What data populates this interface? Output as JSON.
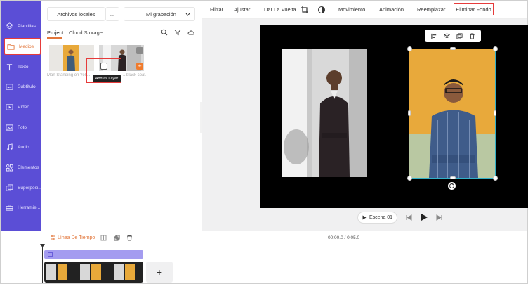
{
  "sidebar": {
    "items": [
      {
        "label": "Plantillas",
        "icon": "layers-icon"
      },
      {
        "label": "Medios",
        "icon": "folder-icon"
      },
      {
        "label": "Texto",
        "icon": "text-icon"
      },
      {
        "label": "Subtítulo",
        "icon": "subtitle-icon"
      },
      {
        "label": "Vídeo",
        "icon": "video-icon"
      },
      {
        "label": "Foto",
        "icon": "photo-icon"
      },
      {
        "label": "Audio",
        "icon": "music-icon"
      },
      {
        "label": "Elementos",
        "icon": "elements-icon"
      },
      {
        "label": "Superposi...",
        "icon": "overlay-icon"
      },
      {
        "label": "Herramie...",
        "icon": "toolbox-icon"
      }
    ],
    "active_index": 1
  },
  "panel": {
    "local_files": "Archivos locales",
    "more": "...",
    "recording": "Mi grabación",
    "tabs": [
      "Project",
      "Cloud Storage"
    ],
    "active_tab": "Project",
    "thumbs": [
      {
        "caption": "Man Standing on Yell..."
      },
      {
        "caption": "...black coat..."
      }
    ],
    "tooltip": "Add as Layer"
  },
  "toolbar": {
    "items": [
      "Filtrar",
      "Ajustar",
      "Dar La Vuelta",
      "Movimiento",
      "Animación",
      "Reemplazar"
    ],
    "highlighted": "Eliminar Fondo"
  },
  "player": {
    "scene": "Escena 01"
  },
  "timeline": {
    "title": "Línea De Tiempo",
    "time": "00:00.0 / 0:05.0",
    "add": "+"
  },
  "colors": {
    "sidebar": "#5b4ed6",
    "accent": "#e2763a",
    "highlight": "#e63b3b",
    "selection": "#32b0c8"
  }
}
